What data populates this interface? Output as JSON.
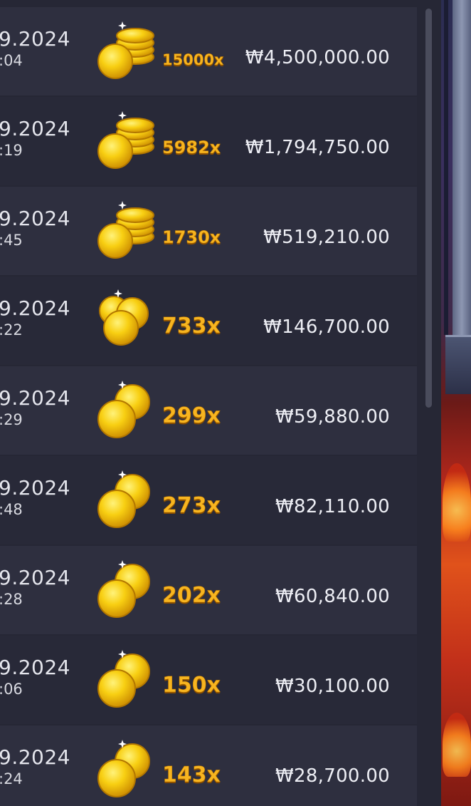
{
  "rows": [
    {
      "date": "9.2024",
      "time": ":04",
      "multiplier": "15000x",
      "amount": "₩4,500,000.00",
      "coin_icon": "coin-stack-large-icon"
    },
    {
      "date": "9.2024",
      "time": ":19",
      "multiplier": "5982x",
      "amount": "₩1,794,750.00",
      "coin_icon": "coin-stack-large-icon"
    },
    {
      "date": "9.2024",
      "time": ":45",
      "multiplier": "1730x",
      "amount": "₩519,210.00",
      "coin_icon": "coin-stack-large-icon"
    },
    {
      "date": "9.2024",
      "time": ":22",
      "multiplier": "733x",
      "amount": "₩146,700.00",
      "coin_icon": "coin-triple-icon"
    },
    {
      "date": "9.2024",
      "time": ":29",
      "multiplier": "299x",
      "amount": "₩59,880.00",
      "coin_icon": "coin-pair-icon"
    },
    {
      "date": "9.2024",
      "time": ":48",
      "multiplier": "273x",
      "amount": "₩82,110.00",
      "coin_icon": "coin-pair-icon"
    },
    {
      "date": "9.2024",
      "time": ":28",
      "multiplier": "202x",
      "amount": "₩60,840.00",
      "coin_icon": "coin-pair-icon"
    },
    {
      "date": "9.2024",
      "time": ":06",
      "multiplier": "150x",
      "amount": "₩30,100.00",
      "coin_icon": "coin-pair-icon"
    },
    {
      "date": "9.2024",
      "time": ":24",
      "multiplier": "143x",
      "amount": "₩28,700.00",
      "coin_icon": "coin-pair-icon"
    }
  ],
  "colors": {
    "panel_background": "#262735",
    "row_light": "#2e2f3f",
    "row_dark": "#282938",
    "multiplier_gold": "#f7b520",
    "coin_gold": "#f5c400",
    "text_light": "#eeeff5"
  }
}
